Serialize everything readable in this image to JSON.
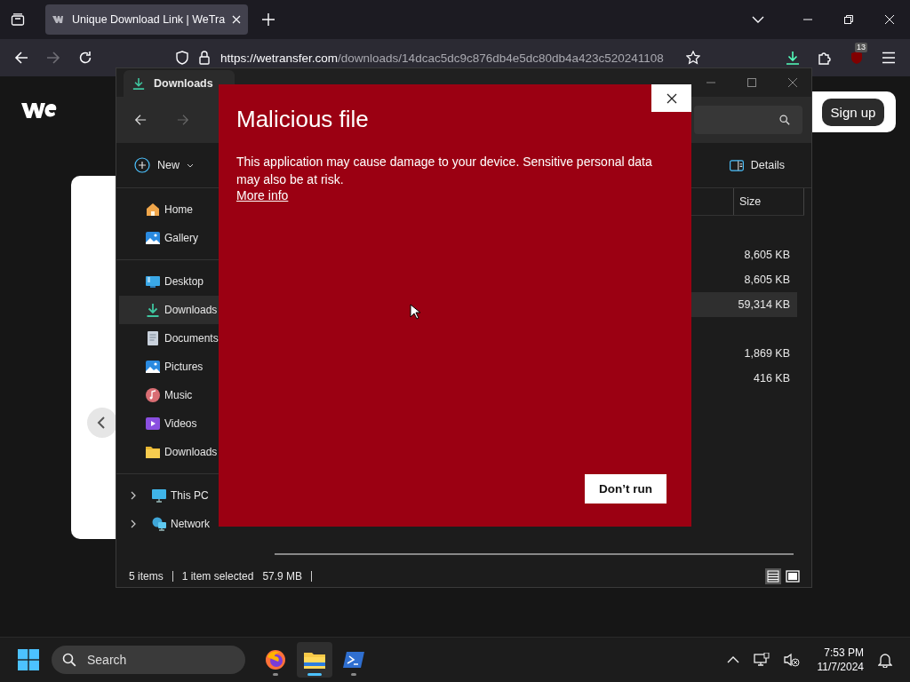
{
  "browser": {
    "tab": {
      "title": "Unique Download Link | WeTra",
      "selected": true
    },
    "url_host": "https://wetransfer.com",
    "url_path": "/downloads/14dcac5dc9c876db4e5dc80db4a423c520241108",
    "extension_badge": "13"
  },
  "page": {
    "sign_up": "Sign up"
  },
  "explorer": {
    "tab": "Downloads",
    "new_button": "New",
    "details_button": "Details",
    "column": "Size",
    "sidebar_sections": [
      {
        "items": [
          {
            "label": "Home",
            "kind": "home",
            "selected": false
          },
          {
            "label": "Gallery",
            "kind": "gallery",
            "selected": false
          }
        ]
      },
      {
        "items": [
          {
            "label": "Desktop",
            "kind": "desktop",
            "selected": false
          },
          {
            "label": "Downloads",
            "kind": "download",
            "selected": true
          },
          {
            "label": "Documents",
            "kind": "document",
            "selected": false
          },
          {
            "label": "Pictures",
            "kind": "gallery",
            "selected": false
          },
          {
            "label": "Music",
            "kind": "music",
            "selected": false
          },
          {
            "label": "Videos",
            "kind": "video",
            "selected": false
          },
          {
            "label": "Downloads",
            "kind": "folder",
            "selected": false
          }
        ]
      }
    ],
    "tree": [
      {
        "label": "This PC",
        "kind": "pc",
        "expanded": false
      },
      {
        "label": "Network",
        "kind": "network",
        "expanded": false
      }
    ],
    "groups": [
      {
        "rows": [
          {
            "size": "8,605 KB",
            "selected": false
          },
          {
            "size": "8,605 KB",
            "selected": false
          },
          {
            "size": "59,314 KB",
            "selected": true
          }
        ]
      },
      {
        "rows": [
          {
            "size": "1,869 KB",
            "selected": false
          },
          {
            "size": "416 KB",
            "selected": false
          }
        ]
      }
    ],
    "status": {
      "items": "5 items",
      "selected": "1 item selected",
      "size": "57.9 MB"
    }
  },
  "dialog": {
    "title": "Malicious file",
    "message": "This application may cause damage to your device. Sensitive personal data may also be at risk.",
    "link": "More info",
    "button": "Don’t run"
  },
  "taskbar": {
    "search": "Search",
    "apps": [
      {
        "kind": "firefox",
        "active": false
      },
      {
        "kind": "explorer",
        "active": true
      },
      {
        "kind": "terminal",
        "active": false
      }
    ],
    "time": "7:53 PM",
    "date": "11/7/2024"
  }
}
